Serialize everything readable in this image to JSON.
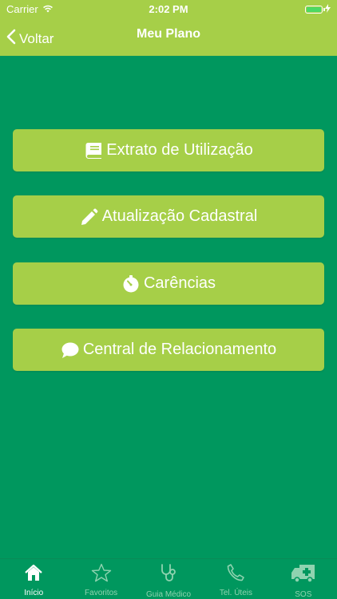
{
  "status_bar": {
    "carrier": "Carrier",
    "time": "2:02 PM",
    "wifi_icon": "wifi-icon",
    "battery_icon": "battery-icon",
    "charging_icon": "bolt-icon"
  },
  "nav": {
    "back_label": "Voltar",
    "title": "Meu Plano"
  },
  "menu": [
    {
      "label": "Extrato de Utilização",
      "icon": "book-icon"
    },
    {
      "label": "Atualização Cadastral",
      "icon": "pencil-icon"
    },
    {
      "label": "Carências",
      "icon": "stopwatch-icon"
    },
    {
      "label": "Central de Relacionamento",
      "icon": "chat-icon"
    }
  ],
  "tabs": [
    {
      "label": "Início",
      "icon": "home-icon",
      "active": true
    },
    {
      "label": "Favoritos",
      "icon": "star-icon",
      "active": false
    },
    {
      "label": "Guia Médico",
      "icon": "stethoscope-icon",
      "active": false
    },
    {
      "label": "Tel. Úteis",
      "icon": "phone-icon",
      "active": false
    },
    {
      "label": "SOS",
      "icon": "ambulance-icon",
      "active": false
    }
  ],
  "colors": {
    "header": "#a6cf48",
    "background": "#00975e",
    "button": "#a6cf48",
    "text": "#ffffff",
    "tab_inactive": "#8fd3b0"
  }
}
